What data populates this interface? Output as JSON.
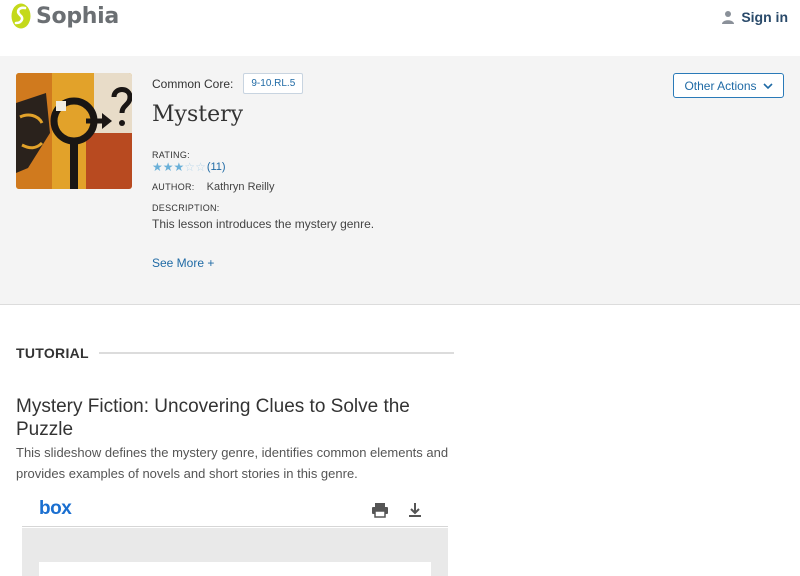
{
  "header": {
    "brand": "Sophia",
    "signin_label": "Sign in",
    "brand_color": "#c4d91a",
    "icons": [
      "sophia-logo-icon",
      "user-icon"
    ]
  },
  "lesson": {
    "common_core_label": "Common Core:",
    "common_core_code": "9-10.RL.5",
    "title": "Mystery",
    "rating_label": "RATING:",
    "rating_stars": 3,
    "rating_max": 5,
    "rating_count": "(11)",
    "author_label": "AUTHOR:",
    "author_name": "Kathryn Reilly",
    "description_label": "DESCRIPTION:",
    "description": "This lesson introduces the mystery genre.",
    "see_more": "See More +",
    "other_actions": "Other Actions",
    "thumbnail_icon": "magnifying-glass-question-art-icon"
  },
  "tutorial": {
    "section_label": "TUTORIAL",
    "title": "Mystery Fiction: Uncovering Clues to Solve the Puzzle",
    "description": "This slideshow defines the mystery genre, identifies common elements and provides examples of novels and short stories in this genre."
  },
  "viewer": {
    "brand": "box",
    "brand_color": "#1a6fd0",
    "icons": [
      "print-icon",
      "download-icon"
    ]
  },
  "colors": {
    "link": "#1f6aa5",
    "star": "#6ab0d8",
    "panel_bg": "#f4f4f4"
  }
}
